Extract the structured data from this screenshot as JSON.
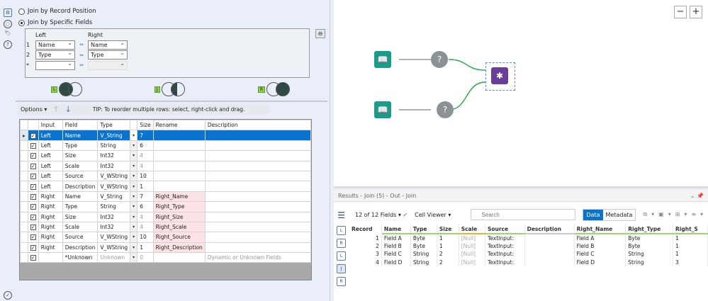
{
  "config": {
    "radio_position": "Join by Record Position",
    "radio_specific": "Join by Specific Fields",
    "join_fields": {
      "left_header": "Left",
      "right_header": "Right",
      "rows": [
        {
          "n": "1",
          "left": "Name",
          "right": "Name"
        },
        {
          "n": "2",
          "left": "Type",
          "right": "Type"
        },
        {
          "n": "*",
          "left": "",
          "right": ""
        }
      ]
    },
    "venn": {
      "left": "L",
      "join": "J",
      "right": "R"
    },
    "options_label": "Options",
    "tip": "TIP: To reorder multiple rows: select, right-click and drag.",
    "columns": [
      "",
      "",
      "Input",
      "Field",
      "Type",
      "",
      "Size",
      "Rename",
      "Description"
    ],
    "rows": [
      {
        "input": "Left",
        "field": "Name",
        "type": "V_String",
        "size": "7",
        "rename": "",
        "desc": ""
      },
      {
        "input": "Left",
        "field": "Type",
        "type": "String",
        "size": "6",
        "rename": "",
        "desc": ""
      },
      {
        "input": "Left",
        "field": "Size",
        "type": "Int32",
        "size": "4",
        "rename": "",
        "desc": ""
      },
      {
        "input": "Left",
        "field": "Scale",
        "type": "Int32",
        "size": "4",
        "rename": "",
        "desc": ""
      },
      {
        "input": "Left",
        "field": "Source",
        "type": "V_WString",
        "size": "10",
        "rename": "",
        "desc": ""
      },
      {
        "input": "Left",
        "field": "Description",
        "type": "V_WString",
        "size": "1",
        "rename": "",
        "desc": ""
      },
      {
        "input": "Right",
        "field": "Name",
        "type": "V_String",
        "size": "7",
        "rename": "Right_Name",
        "desc": ""
      },
      {
        "input": "Right",
        "field": "Type",
        "type": "String",
        "size": "6",
        "rename": "Right_Type",
        "desc": ""
      },
      {
        "input": "Right",
        "field": "Size",
        "type": "Int32",
        "size": "4",
        "rename": "Right_Size",
        "desc": ""
      },
      {
        "input": "Right",
        "field": "Scale",
        "type": "Int32",
        "size": "4",
        "rename": "Right_Scale",
        "desc": ""
      },
      {
        "input": "Right",
        "field": "Source",
        "type": "V_WString",
        "size": "10",
        "rename": "Right_Source",
        "desc": ""
      },
      {
        "input": "Right",
        "field": "Description",
        "type": "V_WString",
        "size": "1",
        "rename": "Right_Description",
        "desc": ""
      },
      {
        "input": "",
        "field": "*Unknown",
        "type": "Unknown",
        "size": "0",
        "rename": "",
        "desc": "Dynamic or Unknown Fields"
      }
    ]
  },
  "canvas": {
    "zoom_out": "−",
    "zoom_in": "+",
    "join_anchors": [
      "L",
      "J",
      "R"
    ]
  },
  "results": {
    "title": "Results - Join (5) - Out - Join",
    "fields": "12 of 12 Fields",
    "cell_viewer": "Cell Viewer",
    "search_placeholder": "Search",
    "data_tab": "Data",
    "metadata_tab": "Metadata",
    "side_icons": [
      "L",
      "R",
      "L",
      "J",
      "R"
    ],
    "columns": [
      "Record",
      "Name",
      "Type",
      "Size",
      "Scale",
      "Source",
      "Description",
      "Right_Name",
      "Right_Type",
      "Right_S"
    ],
    "rows": [
      [
        "1",
        "Field A",
        "Byte",
        "1",
        "[Null]",
        "TextInput:",
        "",
        "Field A",
        "Byte",
        "1"
      ],
      [
        "2",
        "Field B",
        "Byte",
        "1",
        "[Null]",
        "TextInput:",
        "",
        "Field B",
        "Byte",
        "1"
      ],
      [
        "3",
        "Field C",
        "String",
        "2",
        "[Null]",
        "TextInput:",
        "",
        "Field C",
        "String",
        "1"
      ],
      [
        "4",
        "Field D",
        "String",
        "2",
        "[Null]",
        "TextInput:",
        "",
        "Field D",
        "String",
        "3"
      ]
    ]
  },
  "colors": {
    "selected": "#0a73cf",
    "rename_bg": "#fde3e3",
    "join_tool": "#6a3d9a",
    "input_tool": "#1a9c8c",
    "anchor": "#8fd14f"
  }
}
